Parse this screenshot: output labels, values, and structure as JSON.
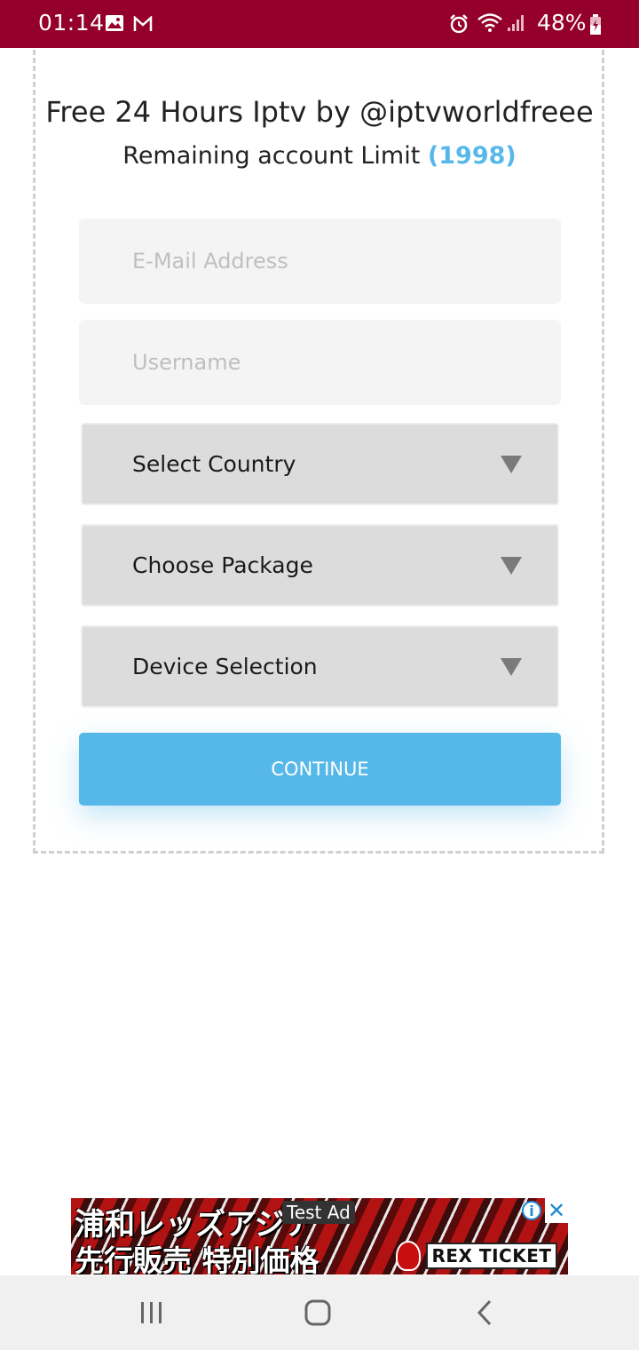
{
  "status_bar": {
    "time": "01:14",
    "battery": "48%",
    "icons": [
      "image-icon",
      "gmail-icon",
      "alarm-icon",
      "wifi-icon",
      "signal-icon",
      "battery-icon"
    ]
  },
  "header": {
    "title": "Free 24 Hours Iptv by @iptvworldfreee",
    "limit_label": "Remaining account Limit",
    "limit_value": "(1998)"
  },
  "form": {
    "email_placeholder": "E-Mail Address",
    "username_placeholder": "Username",
    "country_select": "Select Country",
    "package_select": "Choose Package",
    "device_select": "Device Selection",
    "continue_label": "CONTINUE"
  },
  "ad": {
    "line1": "浦和レッズアジア",
    "line2": "先行販売 特別価格",
    "test_label": "Test Ad",
    "ticket_label": "REX TICKET"
  },
  "colors": {
    "status_bar": "#94002a",
    "accent": "#56b8e8"
  }
}
